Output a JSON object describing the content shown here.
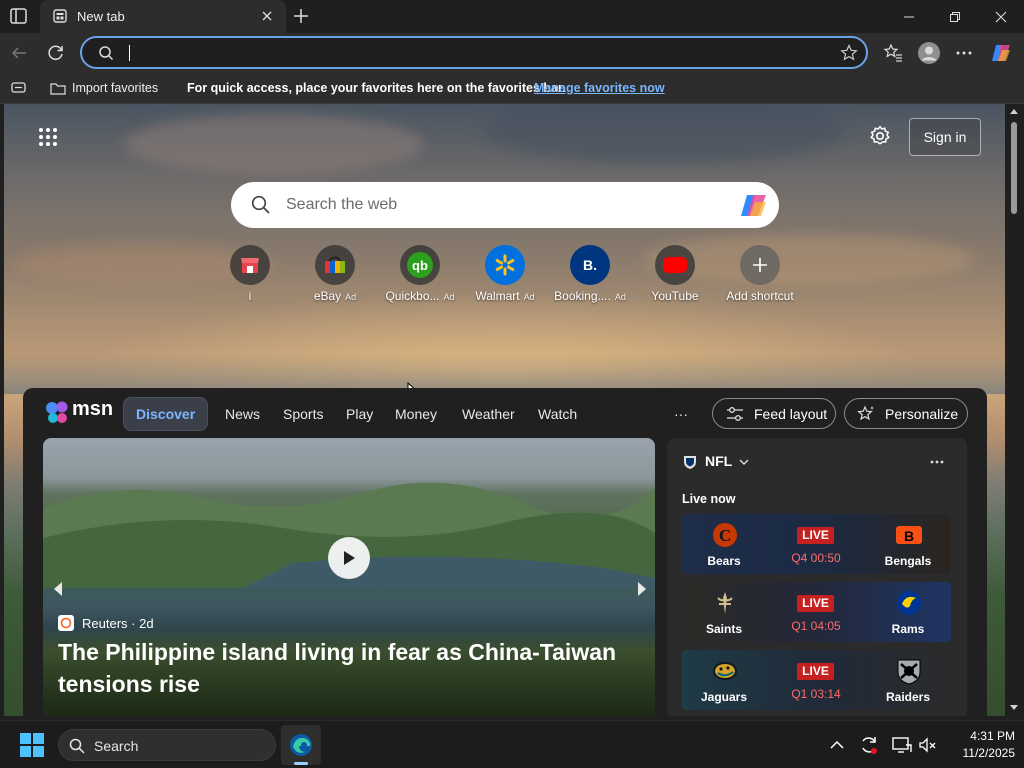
{
  "browser": {
    "tab_title": "New tab",
    "address_value": "",
    "favbar": {
      "import_label": "Import favorites",
      "message": "For quick access, place your favorites here on the favorites bar.",
      "manage_link": "Manage favorites now"
    }
  },
  "newtab": {
    "signin_label": "Sign in",
    "search_placeholder": "Search the web",
    "shortcuts": [
      {
        "label": "i",
        "ad": "",
        "icon": "store-icon"
      },
      {
        "label": "eBay",
        "ad": "Ad",
        "icon": "ebay-icon"
      },
      {
        "label": "Quickbo...",
        "ad": "Ad",
        "icon": "quickbooks-icon"
      },
      {
        "label": "Walmart",
        "ad": "Ad",
        "icon": "walmart-icon"
      },
      {
        "label": "Booking....",
        "ad": "Ad",
        "icon": "booking-icon"
      },
      {
        "label": "YouTube",
        "ad": "",
        "icon": "youtube-icon"
      },
      {
        "label": "Add shortcut",
        "ad": "",
        "icon": "plus-icon"
      }
    ]
  },
  "feed": {
    "brand": "msn",
    "tabs": [
      "Discover",
      "News",
      "Sports",
      "Play",
      "Money",
      "Weather",
      "Watch"
    ],
    "more_label": "···",
    "feed_layout_label": "Feed layout",
    "personalize_label": "Personalize",
    "hero": {
      "source": "Reuters",
      "age": "· 2d",
      "headline": "The Philippine island living in fear as China-Taiwan tensions rise"
    },
    "nfl": {
      "title": "NFL",
      "live_now": "Live now",
      "games": [
        {
          "home": "Bears",
          "away": "Bengals",
          "status": "LIVE",
          "clock": "Q4 00:50"
        },
        {
          "home": "Saints",
          "away": "Rams",
          "status": "LIVE",
          "clock": "Q1 04:05"
        },
        {
          "home": "Jaguars",
          "away": "Raiders",
          "status": "LIVE",
          "clock": "Q1 03:14"
        }
      ]
    }
  },
  "taskbar": {
    "search_label": "Search",
    "time": "4:31 PM",
    "date": "11/2/2025"
  },
  "colors": {
    "accent": "#6aa1e8",
    "live_red": "#c72020",
    "link_blue": "#7fb6ff"
  }
}
